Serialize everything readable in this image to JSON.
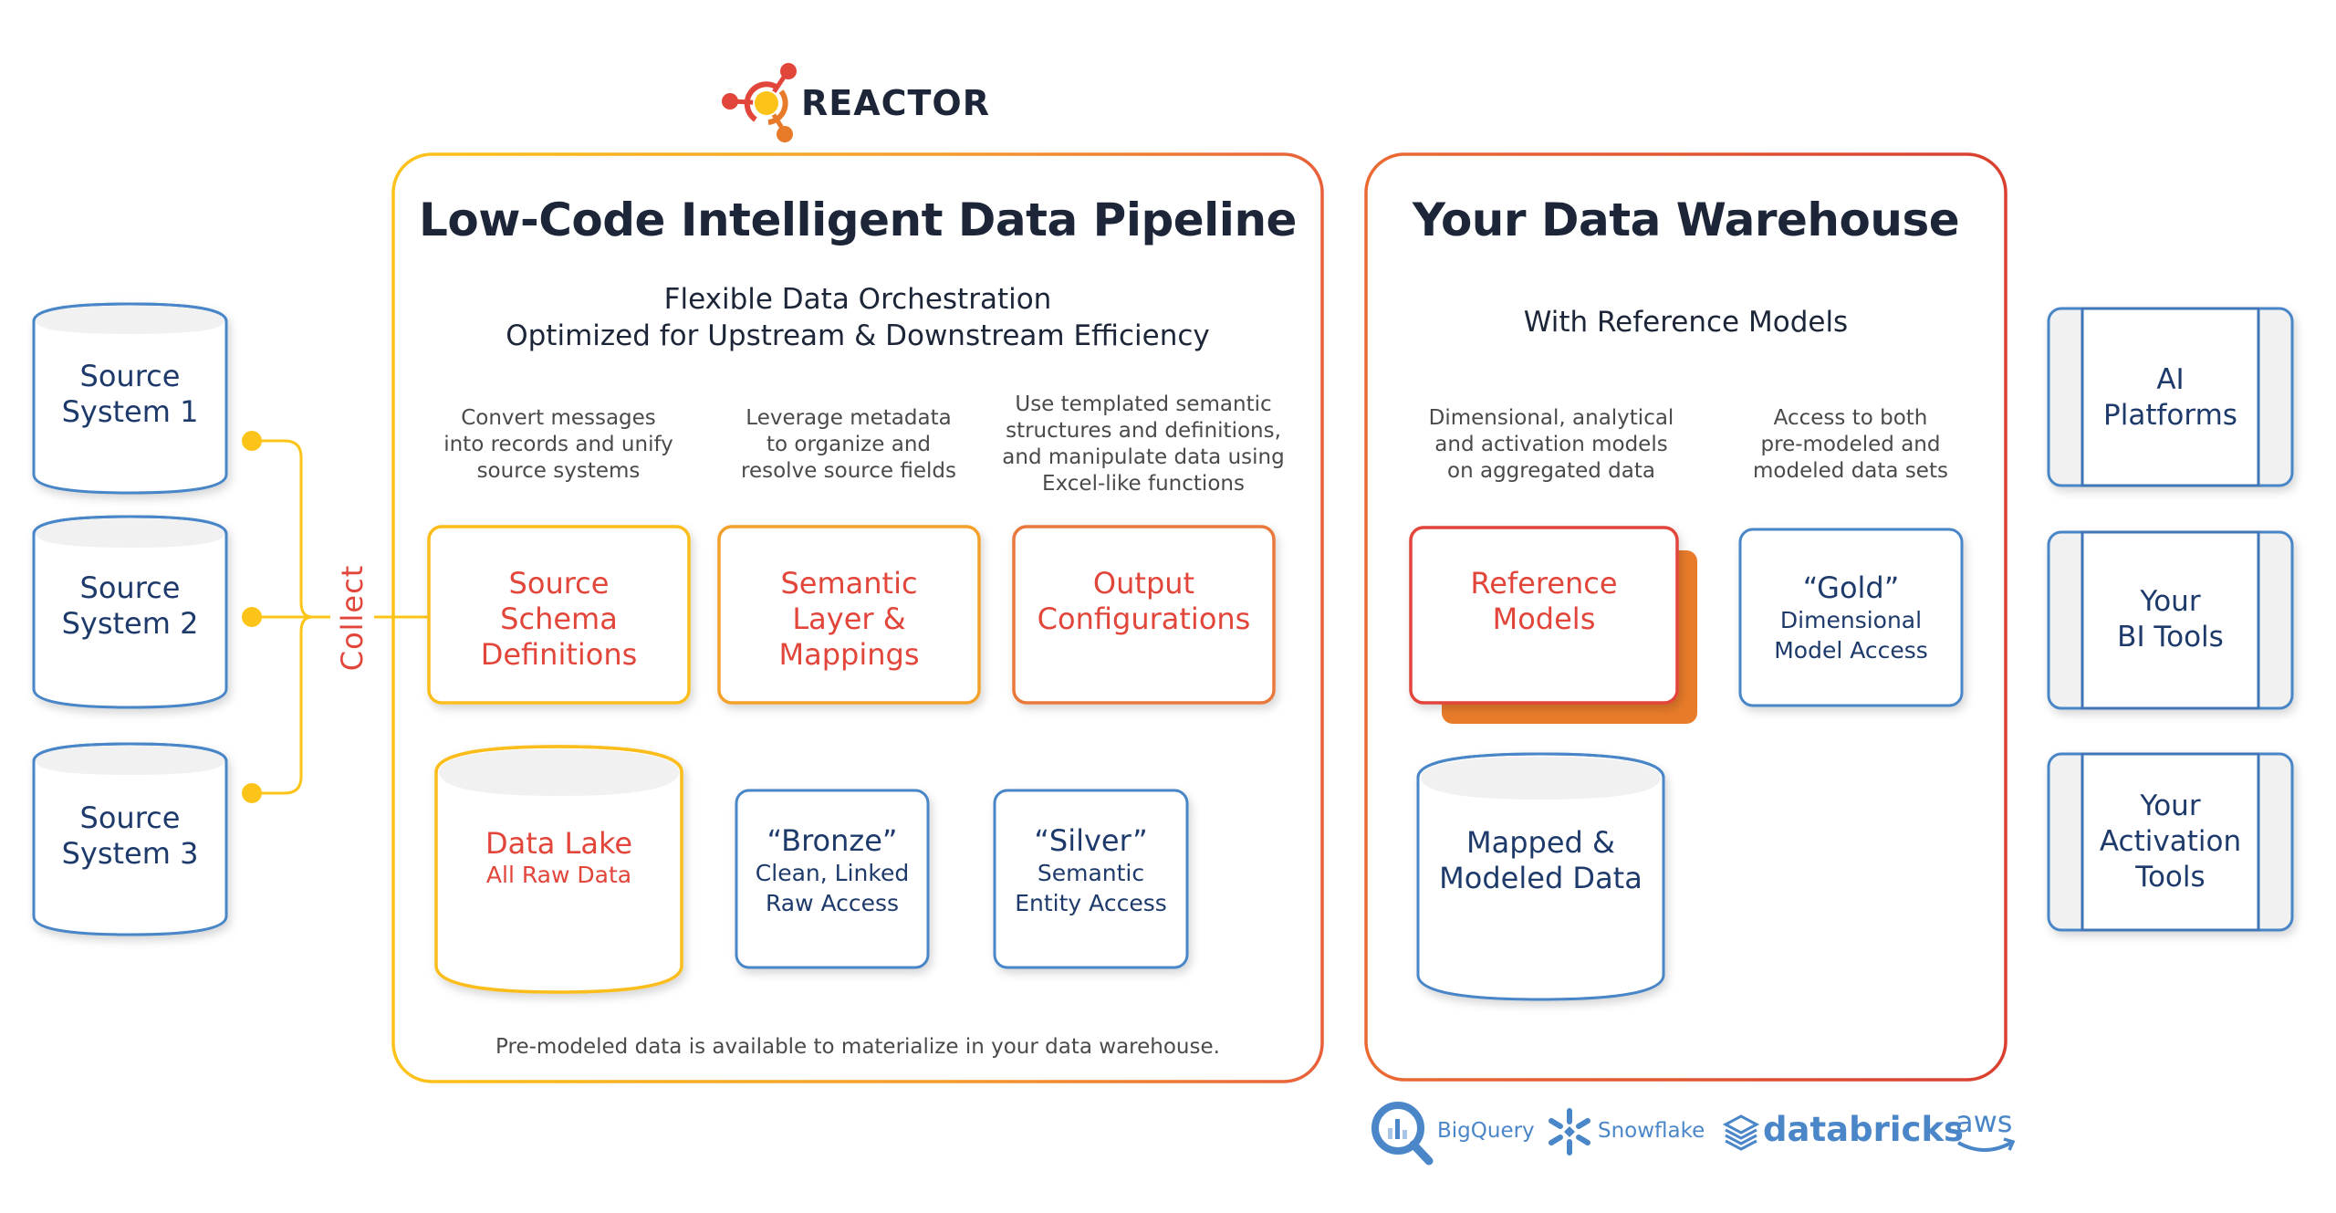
{
  "brand": {
    "name": "REACTOR"
  },
  "collect_label": "Collect",
  "sources": [
    {
      "line1": "Source",
      "line2": "System 1"
    },
    {
      "line1": "Source",
      "line2": "System 2"
    },
    {
      "line1": "Source",
      "line2": "System 3"
    }
  ],
  "pipeline": {
    "title": "Low-Code Intelligent Data Pipeline",
    "subtitle_line1": "Flexible Data Orchestration",
    "subtitle_line2": "Optimized for Upstream & Downstream Efficiency",
    "columns": [
      {
        "description": [
          "Convert messages",
          "into records and unify",
          "source systems"
        ],
        "box": [
          "Source",
          "Schema",
          "Definitions"
        ]
      },
      {
        "description": [
          "Leverage metadata",
          "to organize and",
          "resolve source fields"
        ],
        "box": [
          "Semantic",
          "Layer &",
          "Mappings"
        ]
      },
      {
        "description": [
          "Use templated semantic",
          "structures and definitions,",
          "and manipulate data using",
          "Excel-like functions"
        ],
        "box": [
          "Output",
          "Configurations"
        ]
      }
    ],
    "data_lake": {
      "title": "Data Lake",
      "subtitle": "All Raw Data"
    },
    "bronze": {
      "title": "“Bronze”",
      "line1": "Clean, Linked",
      "line2": "Raw Access"
    },
    "silver": {
      "title": "“Silver”",
      "line1": "Semantic",
      "line2": "Entity Access"
    },
    "footer": "Pre-modeled data is available to materialize in your data warehouse."
  },
  "warehouse": {
    "title": "Your Data Warehouse",
    "subtitle": "With Reference Models",
    "columns": [
      {
        "description": [
          "Dimensional, analytical",
          "and activation models",
          "on aggregated data"
        ]
      },
      {
        "description": [
          "Access to both",
          "pre-modeled and",
          "modeled data sets"
        ]
      }
    ],
    "reference_models": [
      "Reference",
      "Models"
    ],
    "gold": {
      "title": "“Gold”",
      "line1": "Dimensional",
      "line2": "Model Access"
    },
    "mapped": [
      "Mapped &",
      "Modeled Data"
    ]
  },
  "platforms": [
    {
      "name": "BigQuery",
      "icon": "bigquery-icon"
    },
    {
      "name": "Snowflake",
      "icon": "snowflake-icon"
    },
    {
      "name": "databricks",
      "icon": "databricks-icon"
    },
    {
      "name": "aws",
      "icon": "aws-icon"
    }
  ],
  "tools": [
    {
      "line1": "AI",
      "line2": "Platforms"
    },
    {
      "line1": "Your",
      "line2": "BI Tools"
    },
    {
      "line1": "Your",
      "line2": "Activation",
      "line3": "Tools"
    }
  ],
  "colors": {
    "navy": "#1d3a6b",
    "red": "#e2453a",
    "orange": "#e87b2a",
    "yellow": "#fcc419",
    "blue_border": "#4a86c8",
    "panel_gradient_start": "#fbbd1c",
    "panel_gradient_end": "#e5533a"
  }
}
